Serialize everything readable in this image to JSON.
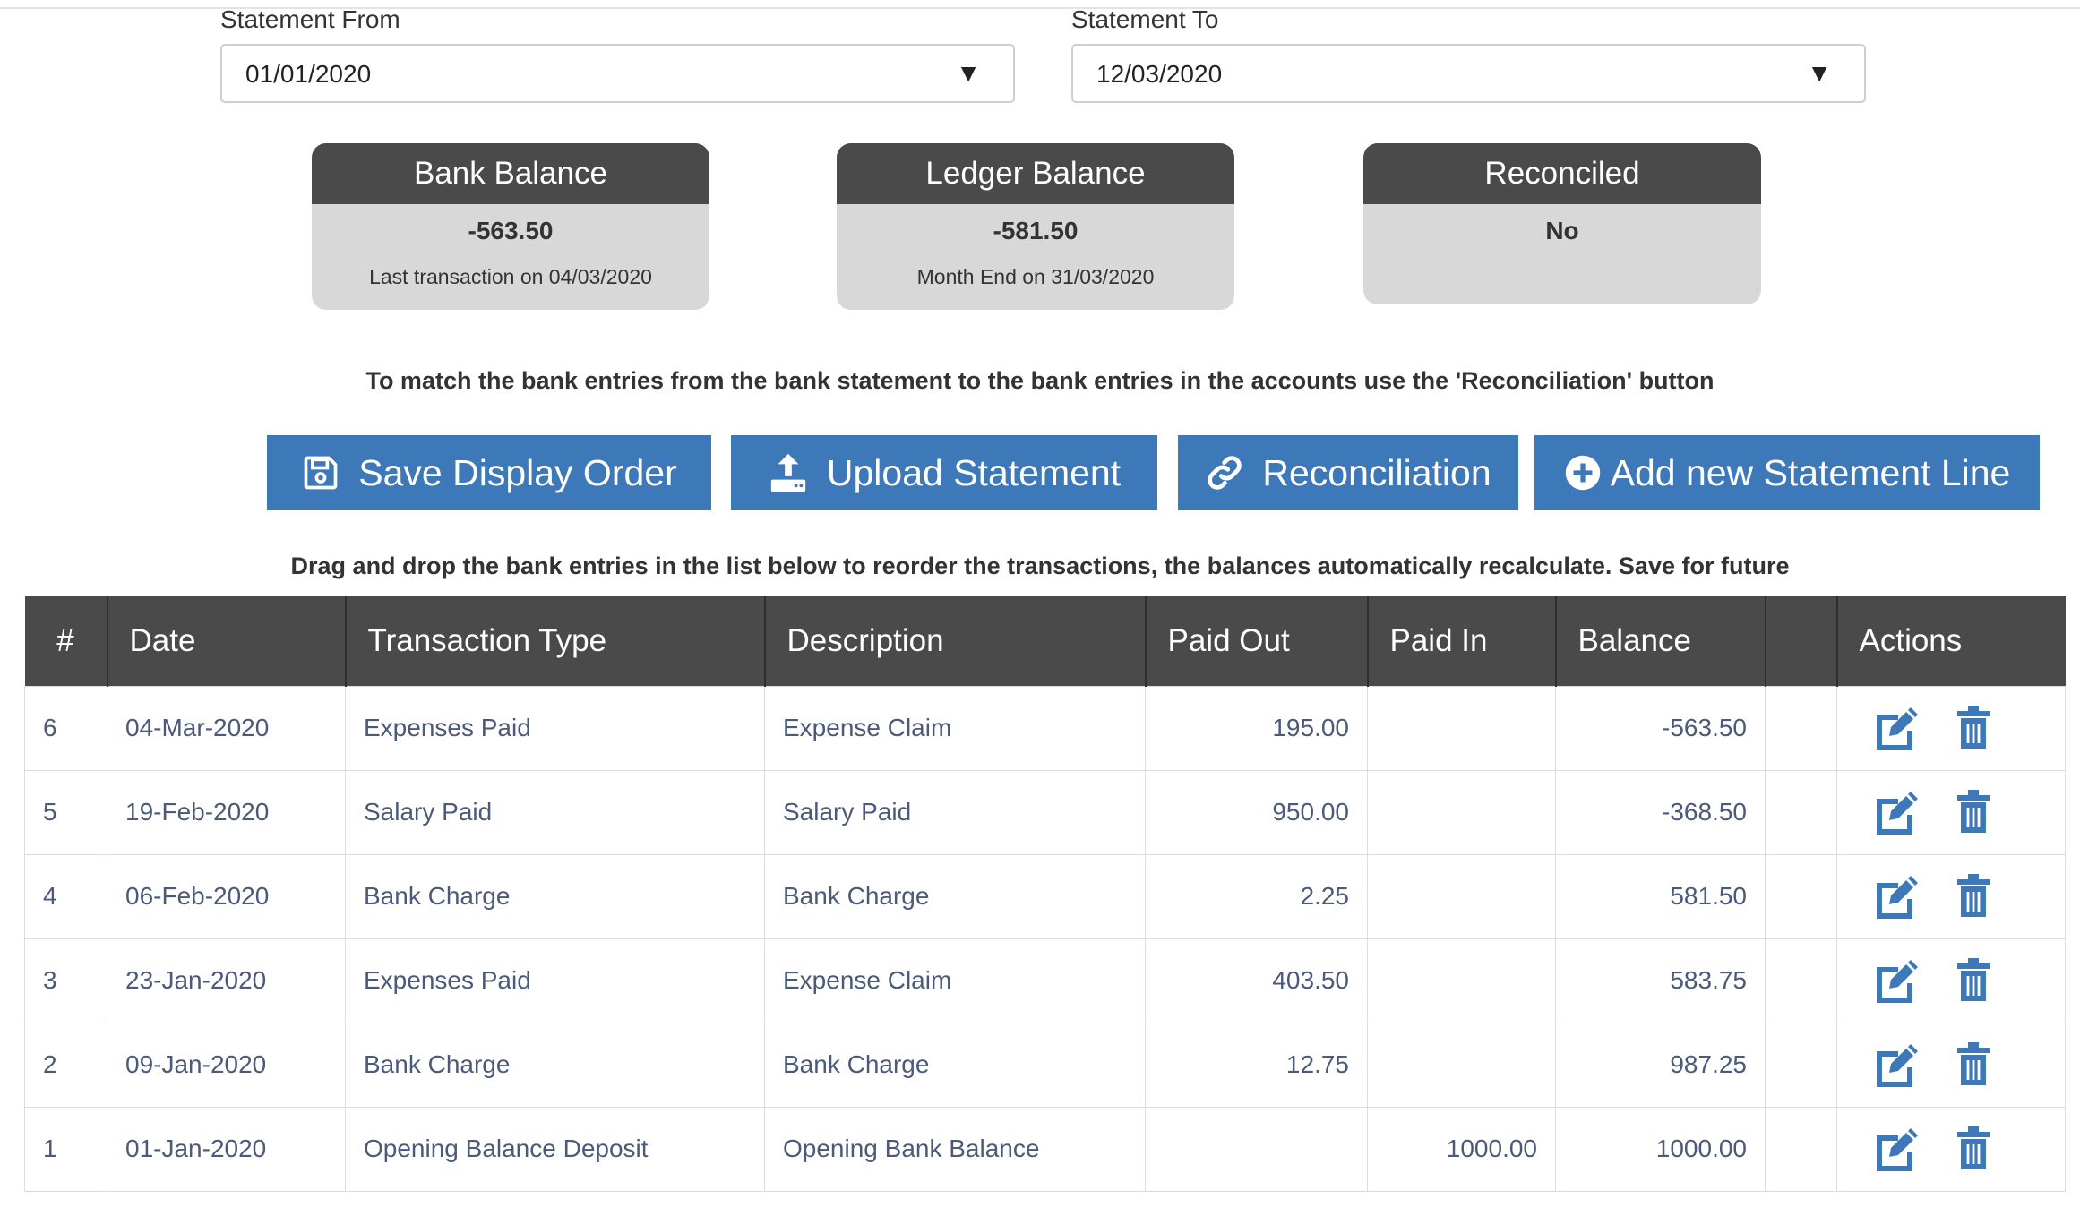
{
  "filters": {
    "from": {
      "label": "Statement From",
      "value": "01/01/2020"
    },
    "to": {
      "label": "Statement To",
      "value": "12/03/2020"
    }
  },
  "cards": {
    "bank": {
      "title": "Bank Balance",
      "value": "-563.50",
      "note": "Last transaction on 04/03/2020"
    },
    "ledger": {
      "title": "Ledger Balance",
      "value": "-581.50",
      "note": "Month End on 31/03/2020"
    },
    "reconciled": {
      "title": "Reconciled",
      "value": "No"
    }
  },
  "info_reconcile": "To match the bank entries from the bank statement to the bank entries in the accounts use the 'Reconciliation' button",
  "buttons": {
    "save_order": "Save Display Order",
    "upload": "Upload Statement",
    "reconciliation": "Reconciliation",
    "add_line": "Add new Statement Line"
  },
  "info_drag": "Drag and drop the bank entries in the list below to reorder the transactions, the balances automatically recalculate. Save for future",
  "table": {
    "headers": [
      "#",
      "Date",
      "Transaction Type",
      "Description",
      "Paid Out",
      "Paid In",
      "Balance",
      "",
      "Actions"
    ],
    "rows": [
      {
        "num": "6",
        "date": "04-Mar-2020",
        "type": "Expenses Paid",
        "desc": "Expense Claim",
        "paid_out": "195.00",
        "paid_in": "",
        "balance": "-563.50"
      },
      {
        "num": "5",
        "date": "19-Feb-2020",
        "type": "Salary Paid",
        "desc": "Salary Paid",
        "paid_out": "950.00",
        "paid_in": "",
        "balance": "-368.50"
      },
      {
        "num": "4",
        "date": "06-Feb-2020",
        "type": "Bank Charge",
        "desc": "Bank Charge",
        "paid_out": "2.25",
        "paid_in": "",
        "balance": "581.50"
      },
      {
        "num": "3",
        "date": "23-Jan-2020",
        "type": "Expenses Paid",
        "desc": "Expense Claim",
        "paid_out": "403.50",
        "paid_in": "",
        "balance": "583.75"
      },
      {
        "num": "2",
        "date": "09-Jan-2020",
        "type": "Bank Charge",
        "desc": "Bank Charge",
        "paid_out": "12.75",
        "paid_in": "",
        "balance": "987.25"
      },
      {
        "num": "1",
        "date": "01-Jan-2020",
        "type": "Opening Balance Deposit",
        "desc": "Opening Bank Balance",
        "paid_out": "",
        "paid_in": "1000.00",
        "balance": "1000.00"
      }
    ]
  },
  "colors": {
    "primary": "#3d78b9",
    "header_dark": "#4a4a4a",
    "card_body": "#d8d8d8",
    "cell_text": "#4b5a7a"
  },
  "icons": {
    "save": "floppy-disk-icon",
    "upload": "upload-icon",
    "reconciliation": "link-icon",
    "add": "plus-circle-icon",
    "edit": "edit-icon",
    "delete": "trash-icon",
    "dropdown": "caret-down-icon"
  }
}
